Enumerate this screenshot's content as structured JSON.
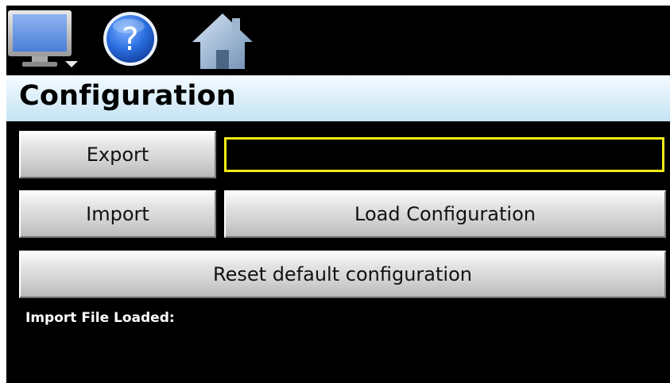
{
  "toolbar": {
    "monitor_icon": "monitor-icon",
    "help_icon": "help-icon",
    "help_glyph": "?",
    "home_icon": "home-icon"
  },
  "header": {
    "title": "Configuration"
  },
  "actions": {
    "export_label": "Export",
    "export_field_value": "",
    "import_label": "Import",
    "load_label": "Load Configuration",
    "reset_label": "Reset default configuration"
  },
  "status": {
    "import_file_label": "Import File Loaded:"
  },
  "colors": {
    "background": "#000000",
    "title_bar": "#d6ecf8",
    "field_border": "#f2ec16",
    "button_face": "#d4d4d4"
  }
}
